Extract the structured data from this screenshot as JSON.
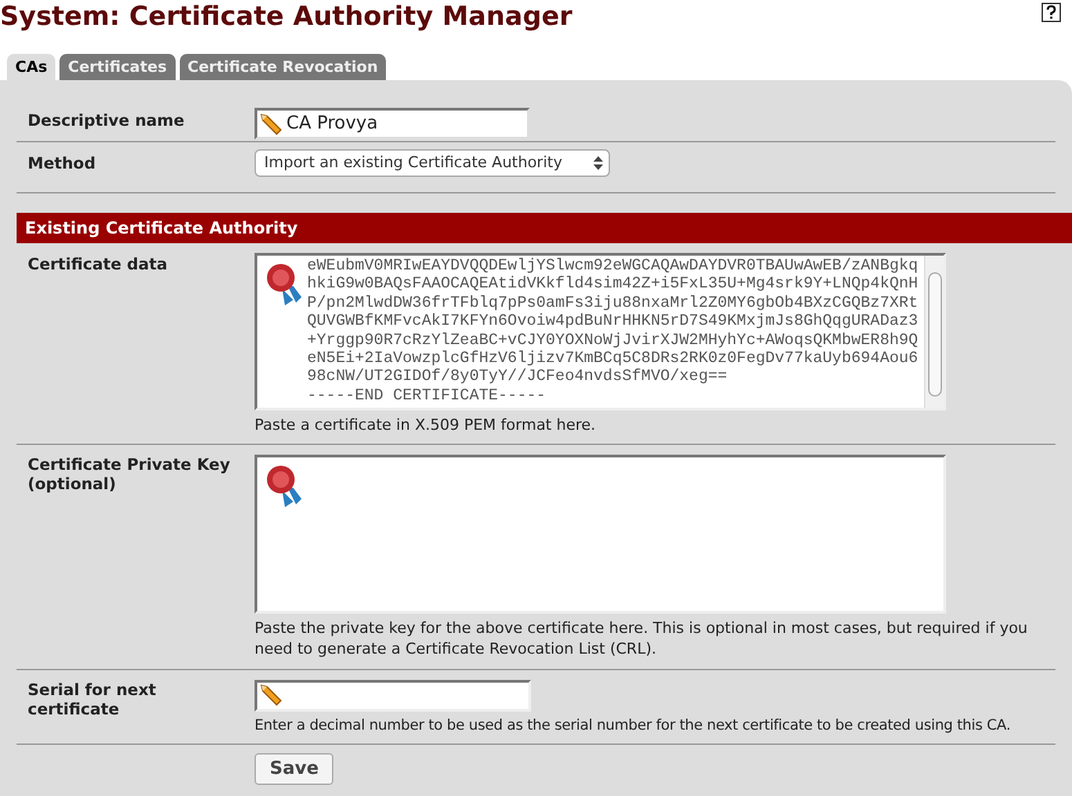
{
  "title": "System: Certificate Authority Manager",
  "tabs": [
    {
      "label": "CAs",
      "selected": true
    },
    {
      "label": "Certificates",
      "selected": false
    },
    {
      "label": "Certificate Revocation",
      "selected": false
    }
  ],
  "form": {
    "descriptive_name": {
      "label": "Descriptive name",
      "value": "CA Provya"
    },
    "method": {
      "label": "Method",
      "value": "Import an existing Certificate Authority"
    },
    "section_header": "Existing Certificate Authority",
    "certificate_data": {
      "label": "Certificate data",
      "value": "eWEubmV0MRIwEAYDVQQDEwljYSlwcm92eWGCAQAwDAYDVR0TBAUwAwEB/zANBgkq\nhkiG9w0BAQsFAAOCAQEAtidVKkfld4sim42Z+i5FxL35U+Mg4srk9Y+LNQp4kQnH\nP/pn2MlwdDW36frTFblq7pPs0amFs3iju88nxaMrl2Z0MY6gbOb4BXzCGQBz7XRt\nQUVGWBfKMFvcAkI7KFYn6Ovoiw4pdBuNrHHKN5rD7S49KMxjmJs8GhQqgURADaz3\n+Yrggp90R7cRzYlZeaBC+vCJY0YOXNoWjJvirXJW2MHyhYc+AWoqsQKMbwER8h9Q\neN5Ei+2IaVowzplcGfHzV6ljizv7KmBCq5C8DRs2RK0z0FegDv77kaUyb694Aou6\n98cNW/UT2GIDOf/8y0TyY//JCFeo4nvdsSfMVO/xeg==\n-----END CERTIFICATE-----",
      "hint": "Paste a certificate in X.509 PEM format here."
    },
    "private_key": {
      "label": "Certificate Private Key (optional)",
      "hint": "Paste the private key for the above certificate here. This is optional in most cases, but required if you need to generate a Certificate Revocation List (CRL)."
    },
    "serial": {
      "label": "Serial for next certificate",
      "hint": "Enter a decimal number to be used as the serial number for the next certificate to be created using this CA."
    },
    "save_button": "Save"
  }
}
